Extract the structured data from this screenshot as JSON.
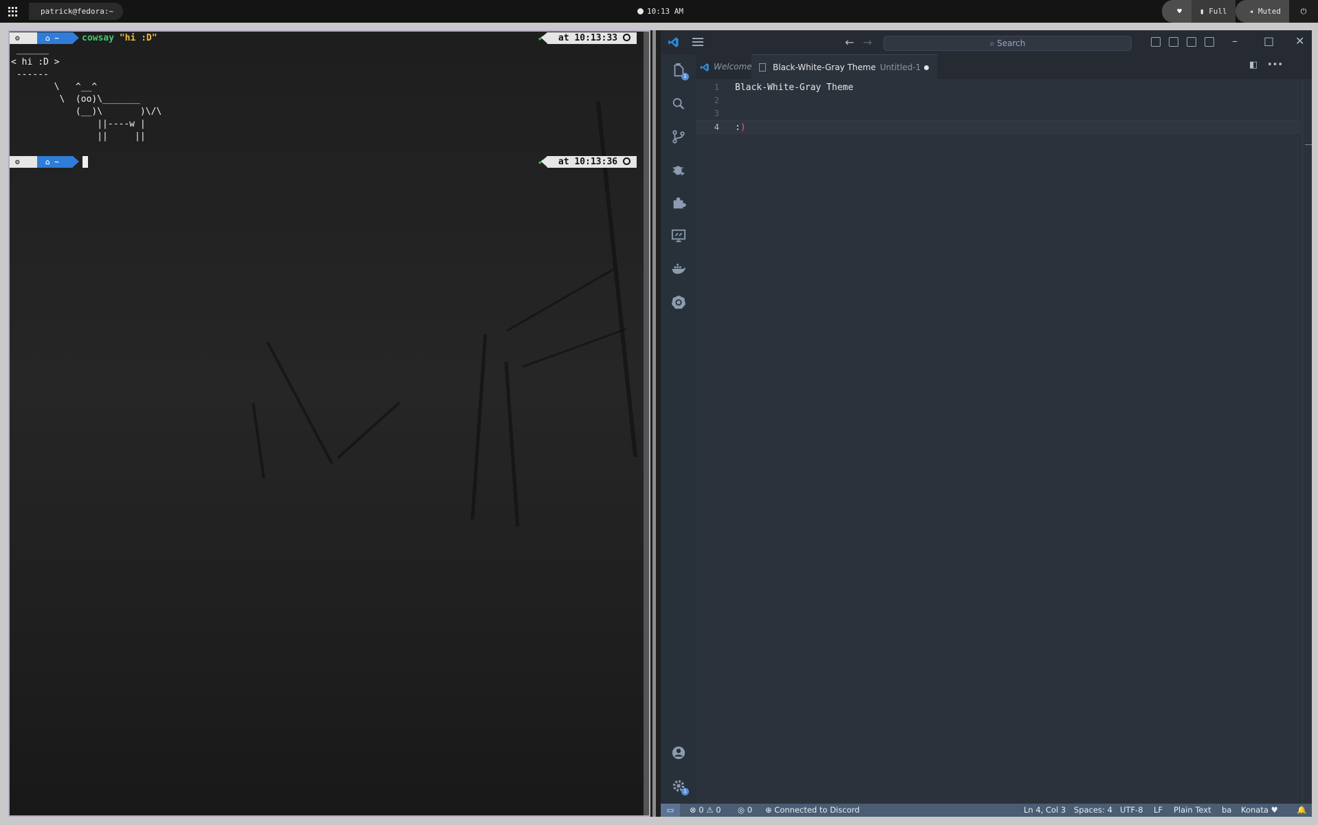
{
  "topbar": {
    "window_title": "patrick@fedora:~",
    "clock": "10:13 AM",
    "power_profile": "Full",
    "volume": "Muted"
  },
  "terminal": {
    "prompt_dir": "~",
    "command_name": "cowsay",
    "command_arg": "\"hi :D\"",
    "time1": "at 10:13:33",
    "time2": "at 10:13:36",
    "cow_output": " ______\n< hi :D >\n ------\n        \\   ^__^\n         \\  (oo)\\_______\n            (__)\\       )\\/\\\n                ||----w |\n                ||     ||"
  },
  "vscode": {
    "search_placeholder": "Search",
    "tabs": [
      {
        "label": "Welcome"
      },
      {
        "label": "Black-White-Gray Theme",
        "sub": "Untitled-1"
      }
    ],
    "lines": [
      {
        "num": "1",
        "text": "Black-White-Gray Theme"
      },
      {
        "num": "2",
        "text": ""
      },
      {
        "num": "3",
        "text": ""
      },
      {
        "num": "4",
        "text_pre": ":",
        "text_paren": ")"
      }
    ],
    "activity_badges": {
      "explorer": "1",
      "settings": "1"
    },
    "status": {
      "errors": "0",
      "warnings": "0",
      "ports": "0",
      "discord": "Connected to Discord",
      "position": "Ln 4, Col 3",
      "spaces": "Spaces: 4",
      "encoding": "UTF-8",
      "eol": "LF",
      "language": "Plain Text",
      "extra": "ba",
      "theme": "Konata"
    }
  }
}
